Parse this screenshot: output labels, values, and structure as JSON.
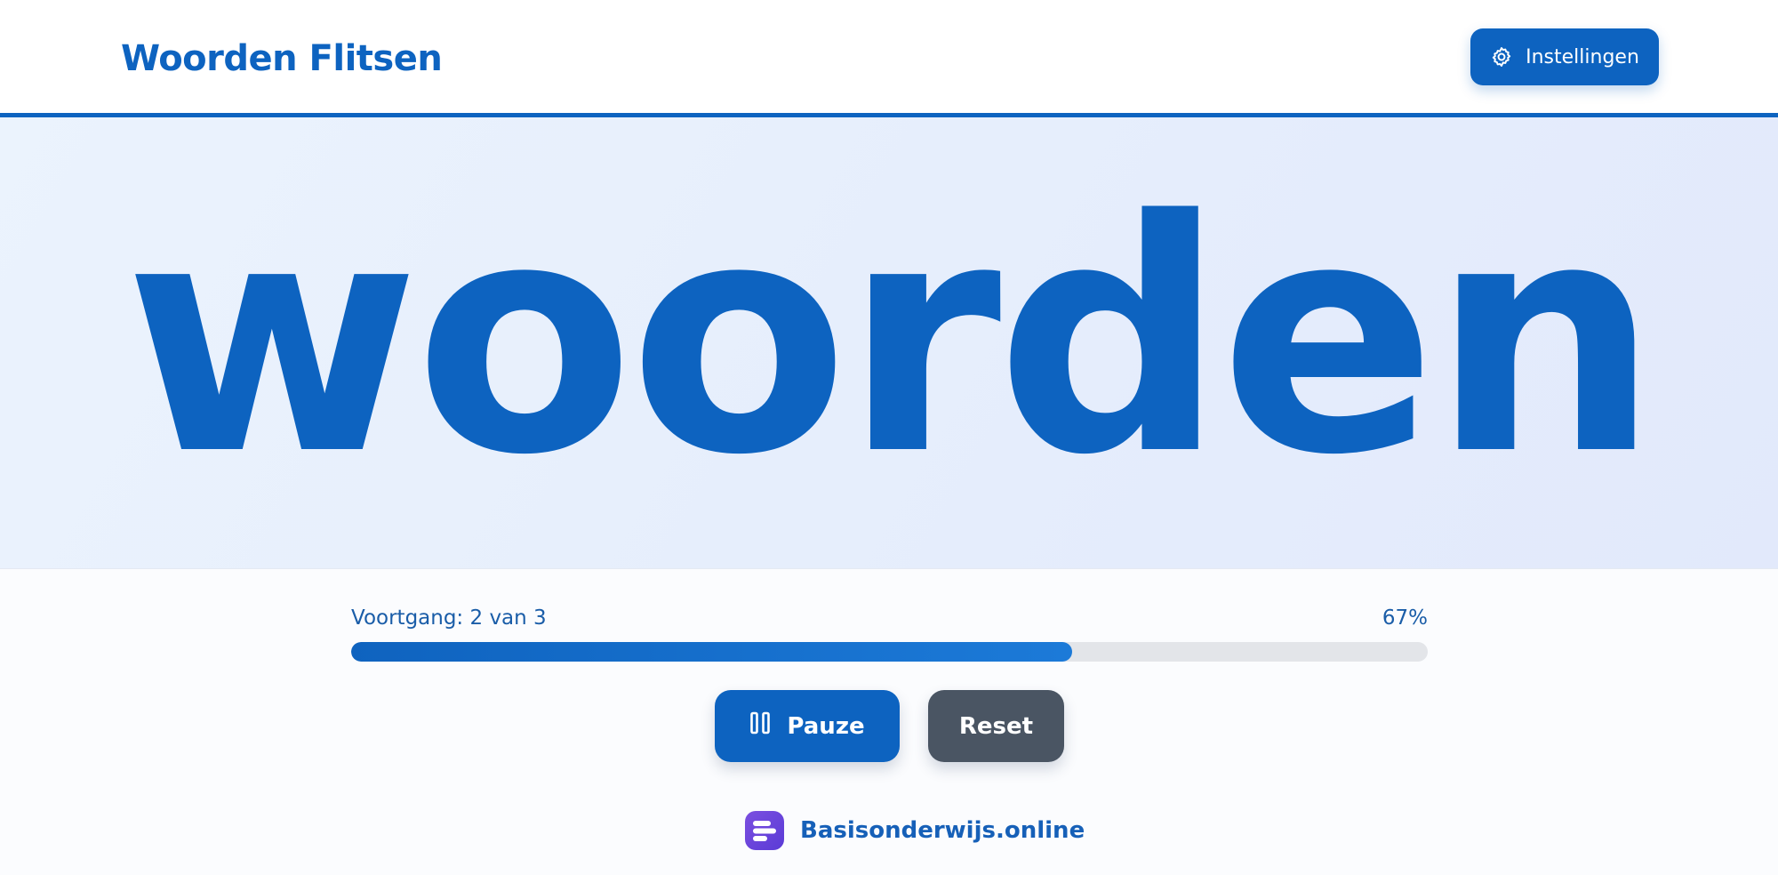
{
  "header": {
    "title": "Woorden Flitsen",
    "settings_label": "Instellingen",
    "settings_icon": "gear-icon"
  },
  "flash": {
    "word": "woorden"
  },
  "progress": {
    "label": "Voortgang: 2 van 3",
    "percent_text": "67%",
    "fraction": 0.67
  },
  "controls": {
    "pause_label": "Pauze",
    "pause_icon": "pause-icon",
    "reset_label": "Reset"
  },
  "brand": {
    "name": "Basisonderwijs.online",
    "logo_icon": "brand-logo-icon"
  },
  "colors": {
    "primary": "#0d63c0",
    "secondary_button": "#4a5563",
    "brand_logo": "#6a45db",
    "track": "#e3e5e9"
  }
}
